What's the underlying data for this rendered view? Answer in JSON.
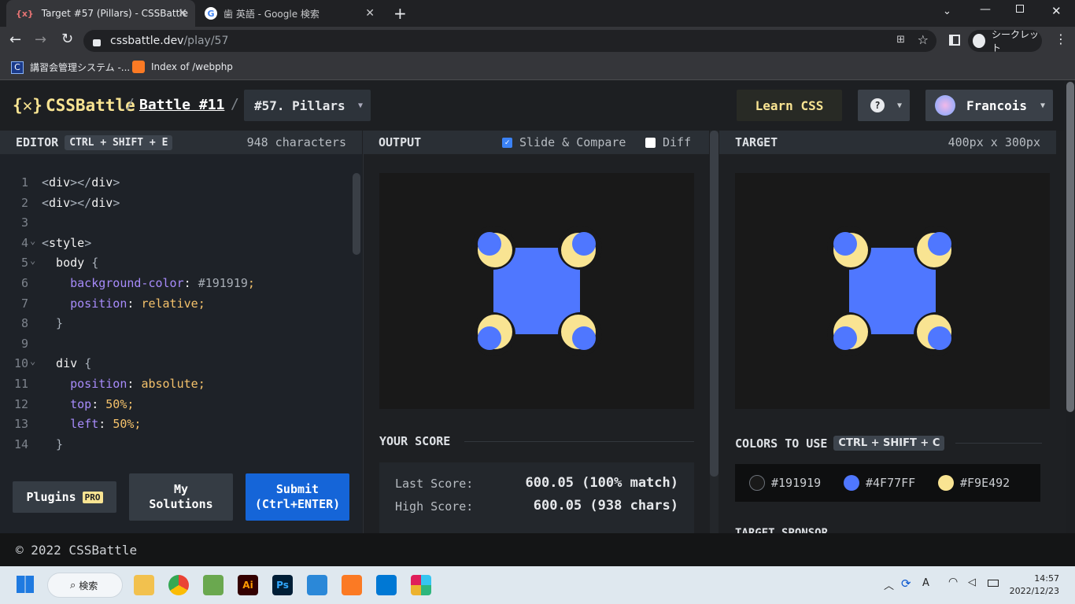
{
  "browser": {
    "tabs": [
      {
        "title": "Target #57 (Pillars) - CSSBattle",
        "favicon": "{x}"
      },
      {
        "title": "歯 英語 - Google 検索",
        "favicon": "G"
      }
    ],
    "url_host": "cssbattle.dev",
    "url_path": "/play/57",
    "incognito_label": "シークレット",
    "bookmarks": [
      {
        "label": "講習会管理システム -..."
      },
      {
        "label": "Index of /webphp"
      }
    ]
  },
  "site": {
    "logo": "CSSBattle",
    "breadcrumb": {
      "battle": "Battle #11",
      "separator": "/",
      "target": "#57. Pillars"
    },
    "learn_css": "Learn CSS",
    "help": "?",
    "user": "Francois"
  },
  "editor": {
    "title": "EDITOR",
    "shortcut": "CTRL + SHIFT + E",
    "char_count": "948 characters",
    "lines": [
      {
        "n": "1",
        "segments": [
          [
            "tg",
            "<"
          ],
          [
            "tn",
            "div"
          ],
          [
            "tg",
            "></"
          ],
          [
            "tn",
            "div"
          ],
          [
            "tg",
            ">"
          ]
        ]
      },
      {
        "n": "2",
        "segments": [
          [
            "tg",
            "<"
          ],
          [
            "tn",
            "div"
          ],
          [
            "tg",
            "></"
          ],
          [
            "tn",
            "div"
          ],
          [
            "tg",
            ">"
          ]
        ]
      },
      {
        "n": "3",
        "segments": []
      },
      {
        "n": "4",
        "fold": true,
        "segments": [
          [
            "tg",
            "<"
          ],
          [
            "tn",
            "style"
          ],
          [
            "tg",
            ">"
          ]
        ]
      },
      {
        "n": "5",
        "fold": true,
        "segments": [
          [
            "tn",
            "  body "
          ],
          [
            "tg",
            "{"
          ]
        ]
      },
      {
        "n": "6",
        "segments": [
          [
            "pr",
            "    background-color"
          ],
          [
            "tn",
            ": "
          ],
          [
            "hx",
            "#191919"
          ],
          [
            "pc",
            ";"
          ]
        ]
      },
      {
        "n": "7",
        "segments": [
          [
            "pr",
            "    position"
          ],
          [
            "tn",
            ": "
          ],
          [
            "vl",
            "relative"
          ],
          [
            "pc",
            ";"
          ]
        ]
      },
      {
        "n": "8",
        "segments": [
          [
            "tg",
            "  }"
          ]
        ]
      },
      {
        "n": "9",
        "segments": []
      },
      {
        "n": "10",
        "fold": true,
        "segments": [
          [
            "tn",
            "  div "
          ],
          [
            "tg",
            "{"
          ]
        ]
      },
      {
        "n": "11",
        "segments": [
          [
            "pr",
            "    position"
          ],
          [
            "tn",
            ": "
          ],
          [
            "vl",
            "absolute"
          ],
          [
            "pc",
            ";"
          ]
        ]
      },
      {
        "n": "12",
        "segments": [
          [
            "pr",
            "    top"
          ],
          [
            "tn",
            ": "
          ],
          [
            "vl",
            "50%"
          ],
          [
            "pc",
            ";"
          ]
        ]
      },
      {
        "n": "13",
        "segments": [
          [
            "pr",
            "    left"
          ],
          [
            "tn",
            ": "
          ],
          [
            "vl",
            "50%"
          ],
          [
            "pc",
            ";"
          ]
        ]
      },
      {
        "n": "14",
        "segments": [
          [
            "tg",
            "  }"
          ]
        ]
      }
    ],
    "plugins": "Plugins",
    "pro": "PRO",
    "my_solutions": "My Solutions",
    "submit_line1": "Submit",
    "submit_line2": "(Ctrl+ENTER)"
  },
  "output": {
    "title": "OUTPUT",
    "slide_compare": "Slide & Compare",
    "diff": "Diff",
    "score_title": "YOUR SCORE",
    "last_score_label": "Last Score:",
    "last_score_value": "600.05 (100% match)",
    "high_score_label": "High Score:",
    "high_score_value": "600.05 (938 chars)"
  },
  "target": {
    "title": "TARGET",
    "size": "400px x 300px",
    "colors_title": "COLORS TO USE",
    "colors_shortcut": "CTRL + SHIFT + C",
    "colors": [
      {
        "hex": "#191919"
      },
      {
        "hex": "#4F77FF"
      },
      {
        "hex": "#F9E492"
      }
    ],
    "sponsor": "TARGET SPONSOR"
  },
  "footer": "© 2022 CSSBattle",
  "taskbar": {
    "search": "検索",
    "time": "14:57",
    "date": "2022/12/23"
  },
  "theme": {
    "bg": "#191919",
    "blue": "#4F77FF",
    "yellow": "#F9E492",
    "accent": "#F9E492"
  }
}
